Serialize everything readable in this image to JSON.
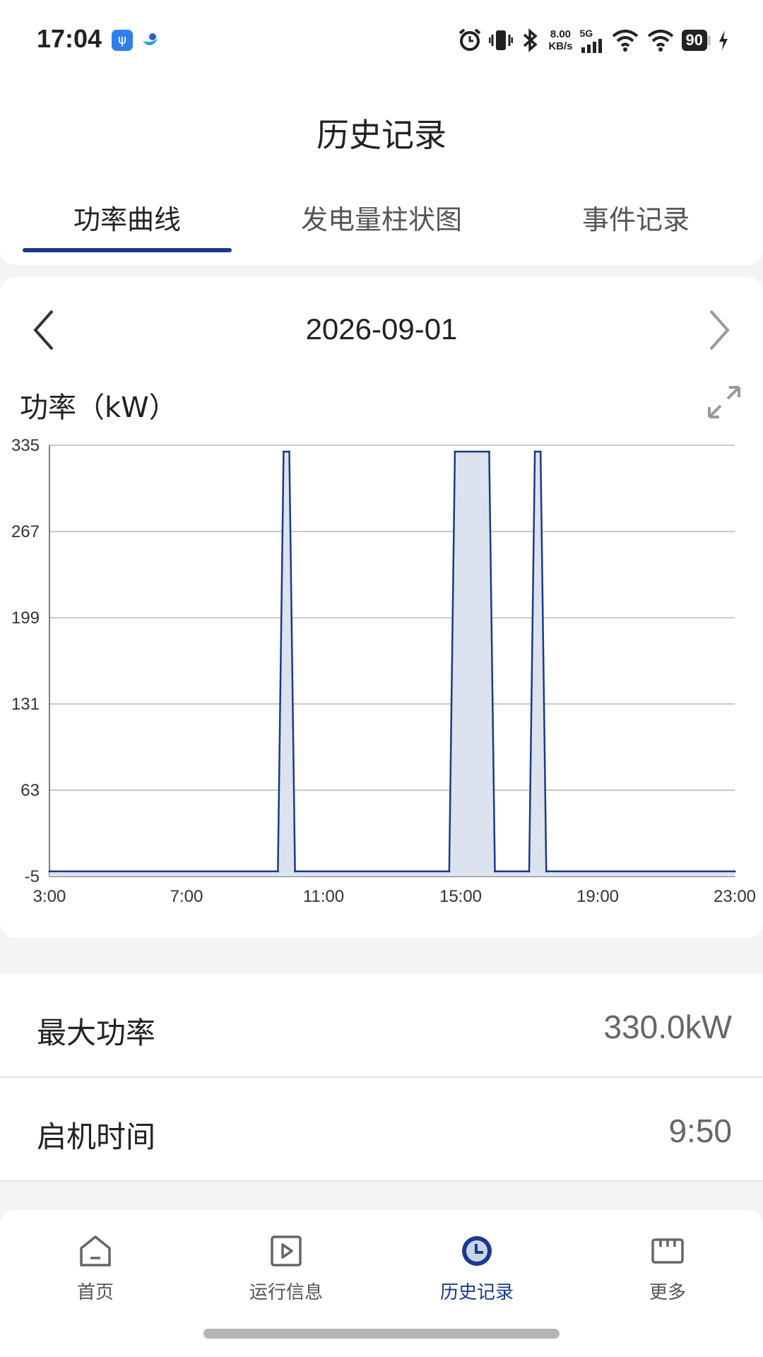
{
  "status_bar": {
    "time": "17:04",
    "net_speed_value": "8.00",
    "net_speed_unit": "KB/s",
    "network_type": "5G",
    "battery": "90",
    "icons": [
      "usb-icon",
      "app-icon",
      "alarm-icon",
      "vibrate-icon",
      "bluetooth-icon",
      "signal-icon",
      "wifi-icon",
      "wifi-icon",
      "charging-icon"
    ]
  },
  "header": {
    "title": "历史记录",
    "tabs": [
      {
        "label": "功率曲线",
        "active": true
      },
      {
        "label": "发电量柱状图",
        "active": false
      },
      {
        "label": "事件记录",
        "active": false
      }
    ]
  },
  "chart_card": {
    "date": "2026-09-01",
    "chart_title": "功率（kW）"
  },
  "chart_data": {
    "type": "area",
    "title": "功率（kW）",
    "xlabel": "",
    "ylabel": "",
    "y_ticks": [
      "335",
      "267",
      "199",
      "131",
      "63",
      "-5"
    ],
    "ylim": [
      -5,
      335
    ],
    "x_ticks": [
      "3:00",
      "7:00",
      "11:00",
      "15:00",
      "19:00",
      "23:00"
    ],
    "xlim": [
      "3:00",
      "23:00"
    ],
    "grid": true,
    "series": [
      {
        "x": [
          "3:00",
          "9:40",
          "9:50",
          "10:00",
          "10:10",
          "14:40",
          "14:50",
          "15:50",
          "16:00",
          "17:00",
          "17:10",
          "17:20",
          "17:30",
          "23:00"
        ],
        "values": [
          -1,
          -1,
          330,
          330,
          -1,
          -1,
          330,
          330,
          -1,
          -1,
          330,
          330,
          -1,
          -1
        ]
      }
    ],
    "colors": {
      "line": "#1a3a8a",
      "fill": "#dde3ee",
      "grid": "#b9b9b9"
    }
  },
  "info": [
    {
      "label": "最大功率",
      "value": "330.0kW"
    },
    {
      "label": "启机时间",
      "value": "9:50"
    }
  ],
  "bottom_nav": [
    {
      "label": "首页",
      "icon": "home-icon",
      "active": false
    },
    {
      "label": "运行信息",
      "icon": "play-icon",
      "active": false
    },
    {
      "label": "历史记录",
      "icon": "clock-icon",
      "active": true
    },
    {
      "label": "更多",
      "icon": "more-icon",
      "active": false
    }
  ]
}
